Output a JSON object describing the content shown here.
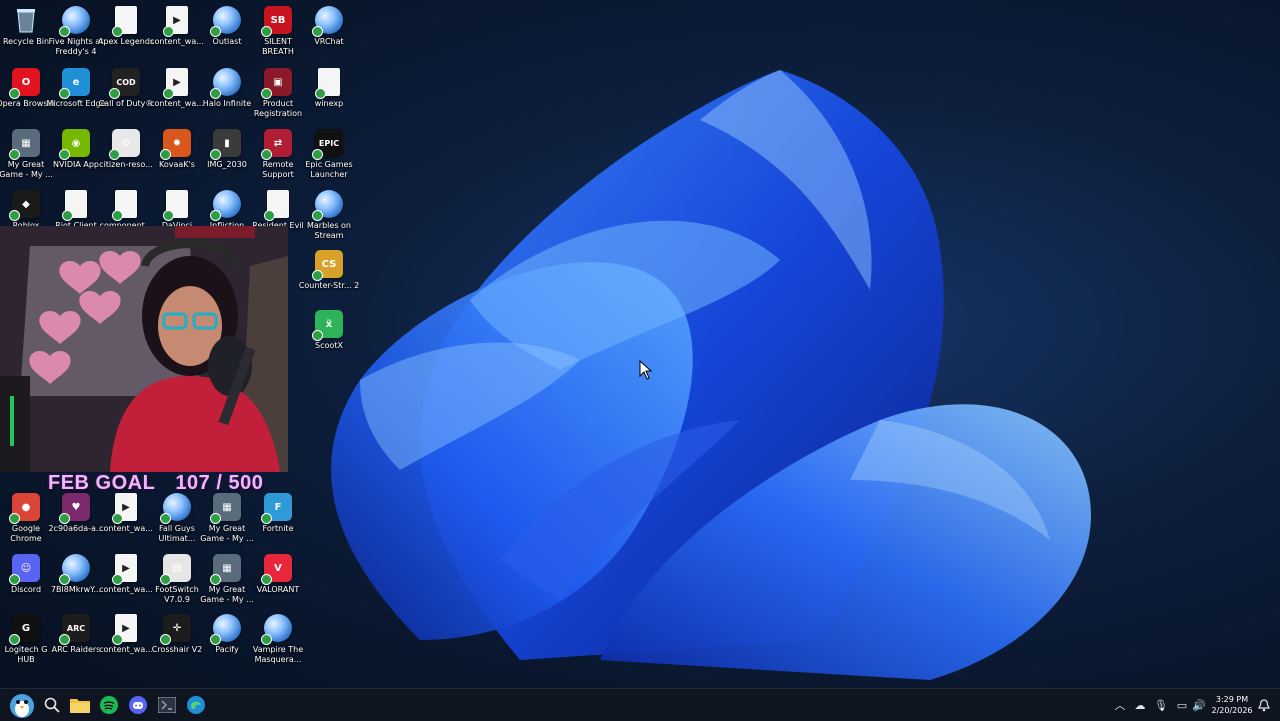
{
  "desktop_icons": [
    {
      "label": "Recycle Bin",
      "icon": "recycle-bin-icon",
      "style": "recycle",
      "color": "#9fd2ff"
    },
    {
      "label": "Five Nights at Freddy's 4",
      "icon": "globe-icon",
      "style": "globe"
    },
    {
      "label": "Apex Legends",
      "icon": "file-icon",
      "style": "file"
    },
    {
      "label": "content_wa...",
      "icon": "video-file-icon",
      "style": "video"
    },
    {
      "label": "Outlast",
      "icon": "globe-icon",
      "style": "globe"
    },
    {
      "label": "SILENT BREATH",
      "icon": "silent-breath-icon",
      "style": "text",
      "text": "SB",
      "color": "#c8141e"
    },
    {
      "label": "VRChat",
      "icon": "globe-icon",
      "style": "globe"
    },
    {
      "label": "Opera Browser",
      "icon": "opera-icon",
      "style": "text",
      "text": "O",
      "color": "#e0131f"
    },
    {
      "label": "Microsoft Edge",
      "icon": "edge-icon",
      "style": "text",
      "text": "e",
      "color": "#1f8fd6"
    },
    {
      "label": "Call of Duty®",
      "icon": "call-of-duty-icon",
      "style": "text",
      "text": "COD",
      "color": "#222222"
    },
    {
      "label": "content_wa...",
      "icon": "video-file-icon",
      "style": "video"
    },
    {
      "label": "Halo Infinite",
      "icon": "globe-icon",
      "style": "globe"
    },
    {
      "label": "Product Registration",
      "icon": "product-registration-icon",
      "style": "text",
      "text": "▣",
      "color": "#8a1a2a"
    },
    {
      "label": "winexp",
      "icon": "file-icon",
      "style": "file"
    },
    {
      "label": "My Great Game - My ...",
      "icon": "game-thumbnail-icon",
      "style": "text",
      "text": "▦",
      "color": "#5a6b7c"
    },
    {
      "label": "NVIDIA App",
      "icon": "nvidia-icon",
      "style": "text",
      "text": "◉",
      "color": "#76b900"
    },
    {
      "label": "citizen-reso...",
      "icon": "settings-file-icon",
      "style": "text",
      "text": "⚙",
      "color": "#e8e8e8"
    },
    {
      "label": "KovaaK's",
      "icon": "kovaaks-icon",
      "style": "text",
      "text": "✹",
      "color": "#d9561c"
    },
    {
      "label": "IMG_2030",
      "icon": "image-file-icon",
      "style": "text",
      "text": "▮",
      "color": "#3b3b3b"
    },
    {
      "label": "Remote Support",
      "icon": "remote-support-icon",
      "style": "text",
      "text": "⇄",
      "color": "#b01d35"
    },
    {
      "label": "Epic Games Launcher",
      "icon": "epic-games-icon",
      "style": "text",
      "text": "EPIC",
      "color": "#111111"
    },
    {
      "label": "Roblox",
      "icon": "roblox-icon",
      "style": "text",
      "text": "◆",
      "color": "#1a1a1a"
    },
    {
      "label": "Riot Client",
      "icon": "file-icon",
      "style": "file"
    },
    {
      "label": "component...",
      "icon": "file-icon",
      "style": "file"
    },
    {
      "label": "DaVinci",
      "icon": "file-icon",
      "style": "file"
    },
    {
      "label": "Infliction",
      "icon": "globe-icon",
      "style": "globe"
    },
    {
      "label": "Resident Evil",
      "icon": "file-icon",
      "style": "file"
    },
    {
      "label": "Marbles on Stream",
      "icon": "globe-icon",
      "style": "globe"
    },
    {
      "label": "Counter-Str... 2",
      "icon": "counter-strike-icon",
      "style": "text",
      "text": "CS",
      "color": "#d8a22a"
    },
    {
      "label": "ScootX",
      "icon": "scootx-icon",
      "style": "text",
      "text": "ẍ",
      "color": "#2fb35a"
    },
    {
      "label": "Google Chrome",
      "icon": "chrome-icon",
      "style": "text",
      "text": "●",
      "color": "#db4437"
    },
    {
      "label": "2c90a6da-a...",
      "icon": "image-file-icon",
      "style": "text",
      "text": "♥",
      "color": "#7c2a6c"
    },
    {
      "label": "content_wa...",
      "icon": "video-file-icon",
      "style": "video"
    },
    {
      "label": "Fall Guys Ultimat...",
      "icon": "globe-icon",
      "style": "globe"
    },
    {
      "label": "My Great Game - My ...",
      "icon": "game-thumbnail-icon",
      "style": "text",
      "text": "▦",
      "color": "#5a6b7c"
    },
    {
      "label": "Fortnite",
      "icon": "fortnite-icon",
      "style": "text",
      "text": "F",
      "color": "#2f9ad8"
    },
    {
      "label": "Discord",
      "icon": "discord-icon",
      "style": "text",
      "text": "☺",
      "color": "#5865f2"
    },
    {
      "label": "7Bl8MkrwY...",
      "icon": "globe-icon",
      "style": "globe"
    },
    {
      "label": "content_wa...",
      "icon": "video-file-icon",
      "style": "video"
    },
    {
      "label": "FootSwitch V7.0.9",
      "icon": "footswitch-icon",
      "style": "text",
      "text": "▤",
      "color": "#e6e6e6"
    },
    {
      "label": "My Great Game - My ...",
      "icon": "game-thumbnail-icon",
      "style": "text",
      "text": "▦",
      "color": "#5a6b7c"
    },
    {
      "label": "VALORANT",
      "icon": "valorant-icon",
      "style": "text",
      "text": "V",
      "color": "#e8283a"
    },
    {
      "label": "Logitech G HUB",
      "icon": "logitech-icon",
      "style": "text",
      "text": "G",
      "color": "#111111"
    },
    {
      "label": "ARC Raiders",
      "icon": "arc-raiders-icon",
      "style": "text",
      "text": "ARC",
      "color": "#1d1d1d"
    },
    {
      "label": "content_wa...",
      "icon": "video-file-icon",
      "style": "video"
    },
    {
      "label": "Crosshair V2",
      "icon": "crosshair-icon",
      "style": "text",
      "text": "✛",
      "color": "#1c1c1c"
    },
    {
      "label": "Pacify",
      "icon": "globe-icon",
      "style": "globe"
    },
    {
      "label": "Vampire The Masquera...",
      "icon": "globe-icon",
      "style": "globe"
    }
  ],
  "overlay": {
    "goal_label": "FEB GOAL",
    "goal_progress": "107 / 500",
    "goal_current": 107,
    "goal_target": 500
  },
  "taskbar": {
    "items": [
      {
        "icon": "penguin-avatar-icon",
        "color": "#4aa3df"
      },
      {
        "icon": "search-icon",
        "color": "#e6e6e6"
      },
      {
        "icon": "file-explorer-icon",
        "color": "#f3c23b"
      },
      {
        "icon": "spotify-icon",
        "color": "#1db954"
      },
      {
        "icon": "discord-icon",
        "color": "#5865f2"
      },
      {
        "icon": "terminal-icon",
        "color": "#9aa5b1"
      },
      {
        "icon": "edge-icon",
        "color": "#1f8fd6"
      }
    ],
    "tray": [
      {
        "icon": "chevron-up-icon",
        "glyph": "︿"
      },
      {
        "icon": "onedrive-icon",
        "glyph": "☁"
      },
      {
        "icon": "microphone-icon",
        "glyph": "🎙"
      },
      {
        "icon": "network-icon",
        "glyph": "▭"
      },
      {
        "icon": "volume-icon",
        "glyph": "🔊"
      },
      {
        "icon": "battery-icon",
        "glyph": "▯"
      }
    ],
    "time": "3:29 PM",
    "date": "2/20/2026",
    "notification_icon": "notification-bell-icon"
  }
}
